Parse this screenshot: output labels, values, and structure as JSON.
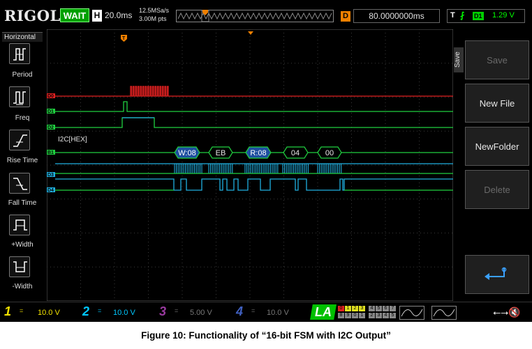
{
  "topbar": {
    "logo": "RIGOL",
    "status": "WAIT",
    "h_label": "H",
    "timebase": "20.0ms",
    "sample_rate": "12.5MSa/s",
    "memory_depth": "3.00M pts",
    "delay_label": "D",
    "delay_value": "80.0000000ms",
    "trigger_label": "T",
    "trigger_source": "D1",
    "trigger_level": "1.29 V"
  },
  "leftbar": {
    "title": "Horizontal",
    "items": [
      {
        "label": "Period",
        "icon": "period-icon"
      },
      {
        "label": "Freq",
        "icon": "freq-icon"
      },
      {
        "label": "Rise Time",
        "icon": "rise-time-icon"
      },
      {
        "label": "Fall Time",
        "icon": "fall-time-icon"
      },
      {
        "label": "+Width",
        "icon": "pos-width-icon"
      },
      {
        "label": "-Width",
        "icon": "neg-width-icon"
      }
    ]
  },
  "channels_digital": [
    {
      "label": "D0",
      "color": "#e02020"
    },
    {
      "label": "D1",
      "color": "#20d040"
    },
    {
      "label": "D2",
      "color": "#20d040"
    },
    {
      "label": "B1",
      "color": "#20d040"
    },
    {
      "label": "D3",
      "color": "#20b0e0"
    },
    {
      "label": "D4",
      "color": "#20b0e0"
    }
  ],
  "bus": {
    "label": "I2C[HEX]",
    "packets": [
      "W:08",
      "EB",
      "R:08",
      "04",
      "00"
    ]
  },
  "rightbar": {
    "tab_label": "Save",
    "keys": [
      {
        "label": "Save",
        "enabled": false
      },
      {
        "label": "New File",
        "enabled": true
      },
      {
        "label": "NewFolder",
        "enabled": true
      },
      {
        "label": "Delete",
        "enabled": false
      },
      {
        "label": "",
        "icon": "enter-arrow-icon",
        "enabled": true
      }
    ]
  },
  "bottombar": {
    "channels": [
      {
        "num": "1",
        "scale": "10.0 V",
        "color": "#f0e000",
        "coupling": "="
      },
      {
        "num": "2",
        "scale": "10.0 V",
        "color": "#00c8ff",
        "coupling": "="
      },
      {
        "num": "3",
        "scale": "5.00 V",
        "color": "#9a3aa0",
        "coupling": "="
      },
      {
        "num": "4",
        "scale": "10.0 V",
        "color": "#4060c0",
        "coupling": "="
      }
    ],
    "la_label": "LA",
    "la_top_digits": [
      "0",
      "1",
      "2",
      "3",
      "4",
      "5",
      "6",
      "7"
    ],
    "la_bottom_digits": [
      "8",
      "9",
      "0",
      "1",
      "2",
      "3",
      "4",
      "5"
    ]
  },
  "colors": {
    "accent_green": "#00c000",
    "d0_red": "#e02020",
    "trace_green": "#20d040",
    "trace_cyan": "#20b0e0",
    "bus_blue": "#1e4fa0",
    "delay_orange": "#f08000"
  },
  "caption": "Figure 10: Functionality of “16-bit FSM with I2C Output”"
}
